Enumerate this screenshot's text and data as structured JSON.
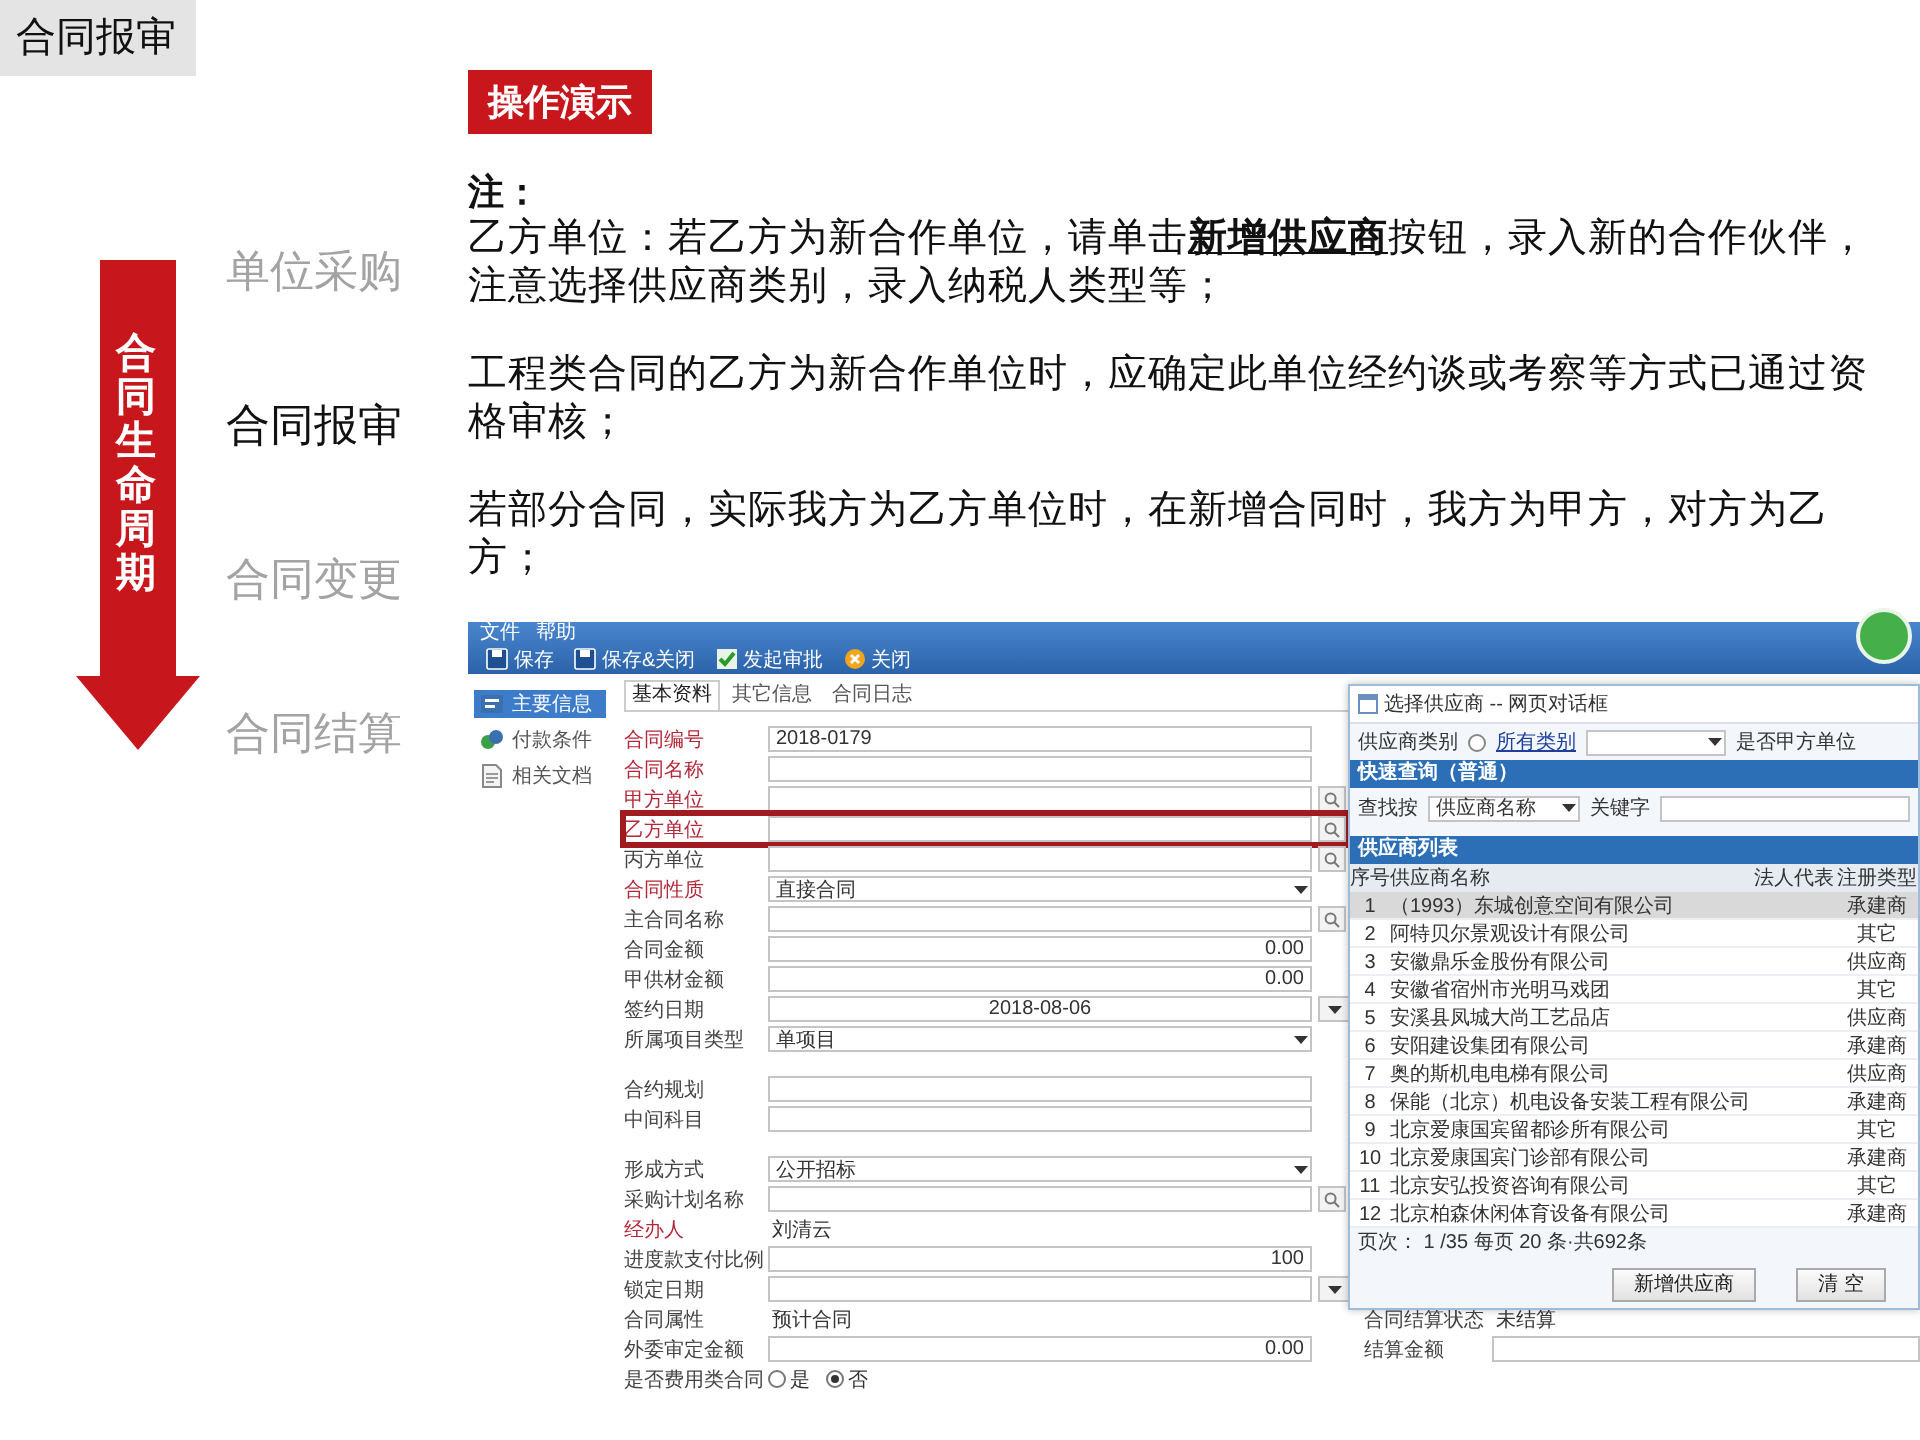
{
  "page_title": "合同报审",
  "lifecycle": {
    "arrow_label": "合同生命周期",
    "stages": [
      {
        "label": "单位采购",
        "selected": false
      },
      {
        "label": "合同报审",
        "selected": true
      },
      {
        "label": "合同变更",
        "selected": false
      },
      {
        "label": "合同结算",
        "selected": false
      }
    ]
  },
  "demo_badge": "操作演示",
  "note": {
    "heading": "注：",
    "paragraphs": [
      "乙方单位：若乙方为新合作单位，请单击**新增供应商**按钮，录入新的合作伙伴，注意选择供应商类别，录入纳税人类型等；",
      "工程类合同的乙方为新合作单位时，应确定此单位经约谈或考察等方式已通过资格审核；",
      "若部分合同，实际我方为乙方单位时，在新增合同时，我方为甲方，对方为乙方；"
    ]
  },
  "app": {
    "menu": [
      "文件",
      "帮助"
    ],
    "toolbar": [
      "保存",
      "保存&关闭",
      "发起审批",
      "关闭"
    ],
    "nav": [
      {
        "label": "主要信息",
        "selected": true
      },
      {
        "label": "付款条件",
        "selected": false
      },
      {
        "label": "相关文档",
        "selected": false
      }
    ],
    "tabs": [
      {
        "label": "基本资料",
        "selected": true
      },
      {
        "label": "其它信息",
        "selected": false
      },
      {
        "label": "合同日志",
        "selected": false
      }
    ],
    "form_groups": [
      [
        {
          "label": "合同编号",
          "required": true,
          "kind": "text",
          "value": "2018-0179"
        },
        {
          "label": "合同名称",
          "required": true,
          "kind": "text"
        },
        {
          "label": "甲方单位",
          "required": true,
          "kind": "lookup"
        },
        {
          "label": "乙方单位",
          "required": true,
          "kind": "lookup",
          "highlighted": true
        },
        {
          "label": "丙方单位",
          "required": false,
          "kind": "lookup"
        },
        {
          "label": "合同性质",
          "required": true,
          "kind": "select",
          "value": "直接合同"
        },
        {
          "label": "主合同名称",
          "required": false,
          "kind": "lookup"
        },
        {
          "label": "合同金额",
          "required": false,
          "kind": "number",
          "value": "0.00"
        },
        {
          "label": "甲供材金额",
          "required": false,
          "kind": "number",
          "value": "0.00"
        },
        {
          "label": "签约日期",
          "required": false,
          "kind": "date",
          "value": "2018-08-06"
        },
        {
          "label": "所属项目类型",
          "required": false,
          "kind": "select",
          "value": "单项目"
        }
      ],
      [
        {
          "label": "合约规划",
          "required": false,
          "kind": "text"
        },
        {
          "label": "中间科目",
          "required": false,
          "kind": "text"
        }
      ],
      [
        {
          "label": "形成方式",
          "required": false,
          "kind": "select",
          "value": "公开招标"
        },
        {
          "label": "采购计划名称",
          "required": false,
          "kind": "lookup"
        },
        {
          "label": "经办人",
          "required": true,
          "kind": "plain",
          "value": "刘清云"
        },
        {
          "label": "进度款支付比例",
          "required": false,
          "kind": "number",
          "value": "100"
        },
        {
          "label": "锁定日期",
          "required": false,
          "kind": "date"
        },
        {
          "label": "合同属性",
          "required": false,
          "kind": "plain",
          "value": "预计合同",
          "right": {
            "label": "合同结算状态",
            "kind": "plain",
            "value": "未结算"
          }
        },
        {
          "label": "外委审定金额",
          "required": false,
          "kind": "number",
          "value": "0.00",
          "right": {
            "label": "结算金额",
            "kind": "text"
          }
        },
        {
          "label": "是否费用类合同",
          "required": false,
          "kind": "radio",
          "options": [
            {
              "label": "是",
              "selected": false
            },
            {
              "label": "否",
              "selected": true
            }
          ]
        }
      ]
    ],
    "dialog": {
      "title": "选择供应商 -- 网页对话框",
      "category_label": "供应商类别",
      "category_value": "所有类别",
      "party_a_label": "是否甲方单位",
      "quick_search_title": "快速查询（普通）",
      "search_by_label": "查找按",
      "search_by_value": "供应商名称",
      "keyword_label": "关键字",
      "list_title": "供应商列表",
      "columns": [
        "序号",
        "供应商名称",
        "法人代表",
        "注册类型"
      ],
      "rows": [
        {
          "no": "1",
          "name": "（1993）东城创意空间有限公司",
          "type": "承建商",
          "selected": true
        },
        {
          "no": "2",
          "name": "阿特贝尔景观设计有限公司",
          "type": "其它",
          "selected": false
        },
        {
          "no": "3",
          "name": "安徽鼎乐金股份有限公司",
          "type": "供应商",
          "selected": false
        },
        {
          "no": "4",
          "name": "安徽省宿州市光明马戏团",
          "type": "其它",
          "selected": false
        },
        {
          "no": "5",
          "name": "安溪县凤城大尚工艺品店",
          "type": "供应商",
          "selected": false
        },
        {
          "no": "6",
          "name": "安阳建设集团有限公司",
          "type": "承建商",
          "selected": false
        },
        {
          "no": "7",
          "name": "奥的斯机电电梯有限公司",
          "type": "供应商",
          "selected": false
        },
        {
          "no": "8",
          "name": "保能（北京）机电设备安装工程有限公司",
          "type": "承建商",
          "selected": false
        },
        {
          "no": "9",
          "name": "北京爱康国宾留都诊所有限公司",
          "type": "其它",
          "selected": false
        },
        {
          "no": "10",
          "name": "北京爱康国宾门诊部有限公司",
          "type": "承建商",
          "selected": false
        },
        {
          "no": "11",
          "name": "北京安弘投资咨询有限公司",
          "type": "其它",
          "selected": false
        },
        {
          "no": "12",
          "name": "北京柏森休闲体育设备有限公司",
          "type": "承建商",
          "selected": false
        }
      ],
      "pager": "页次： 1 /35  每页 20 条·共692条",
      "buttons": [
        "新增供应商",
        "清 空"
      ]
    }
  }
}
